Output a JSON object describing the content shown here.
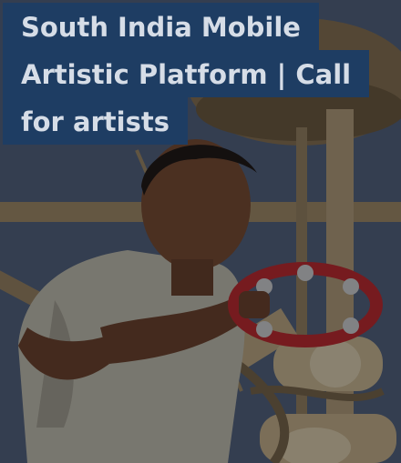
{
  "post": {
    "title_lines": [
      "South India Mobile",
      "Artistic Platform | Call",
      "for artists"
    ]
  },
  "colors": {
    "title_bg": "#1e3d63",
    "title_text": "#d6dde7",
    "sky": "#5b6a8a",
    "bamboo": "#b8a27d"
  },
  "image": {
    "subject": "boy-with-tambourine-on-bamboo-structure"
  }
}
